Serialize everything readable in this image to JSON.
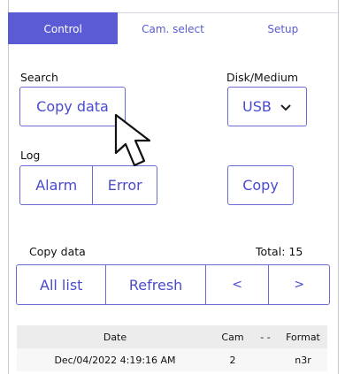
{
  "tabs": [
    {
      "label": "Control",
      "active": true
    },
    {
      "label": "Cam. select",
      "active": false
    },
    {
      "label": "Setup",
      "active": false
    }
  ],
  "search": {
    "label": "Search",
    "copy_data_button": "Copy data"
  },
  "disk": {
    "label": "Disk/Medium",
    "selected": "USB",
    "chevron": "chevron-down-icon"
  },
  "log": {
    "label": "Log",
    "alarm_button": "Alarm",
    "error_button": "Error"
  },
  "copy_button": "Copy",
  "copy_data": {
    "label": "Copy data",
    "total": "Total: 15",
    "all_list_button": "All list",
    "refresh_button": "Refresh",
    "prev_button": "<",
    "next_button": ">"
  },
  "table": {
    "headers": {
      "date": "Date",
      "cam": "Cam",
      "dash": "- -",
      "format": "Format"
    },
    "rows": [
      {
        "date": "Dec/04/2022 4:19:16 AM",
        "cam": "2",
        "dash": "",
        "format": "n3r"
      }
    ]
  },
  "colors": {
    "accent": "#5b5bd6",
    "border": "#6b6bd6"
  }
}
